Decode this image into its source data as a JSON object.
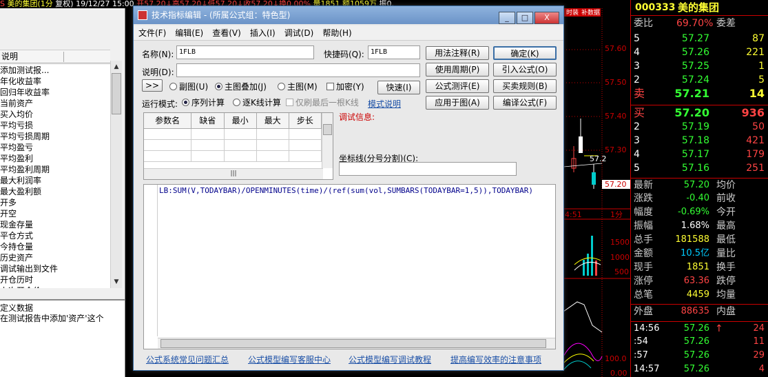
{
  "ticker": {
    "name": "美的集团(1分",
    "date": "复权) 19/12/27 15:00",
    "open": "开57.20",
    "high": "高57.20",
    "low": "低57.20",
    "close": "收57.20",
    "turnover": "换0.00%",
    "volume": "量1851",
    "amount": "额1059万",
    "amp": "振0."
  },
  "left": {
    "header": "说明",
    "items": [
      "添加测试报...",
      "年化收益率",
      "回归年收益率",
      "当前资产",
      "买入均价",
      "平均亏损",
      "平均亏损周期",
      "平均盈亏",
      "平均盈利",
      "平均盈利周期",
      "最大利润率",
      "最大盈利额",
      "开多",
      "开空",
      "现金存量",
      "平仓方式",
      "今持仓量",
      "历史资产",
      "调试输出到文件",
      "开仓历时",
      "上次开仓价"
    ],
    "desc_title": "定义数据",
    "desc_text": "在测试报告中添加'资产'这个"
  },
  "dialog": {
    "title": "技术指标编辑 - (所属公式组：特色型)",
    "title_buttons": [
      "_",
      "□",
      "X"
    ],
    "menu": [
      "文件(F)",
      "编辑(E)",
      "查看(V)",
      "插入(I)",
      "调试(D)",
      "帮助(H)"
    ],
    "name_label": "名称(N):",
    "name_value": "1FLB",
    "hotkey_label": "快捷码(Q):",
    "hotkey_value": "1FLB",
    "desc_label": "说明(D):",
    "desc_value": "",
    "expand_btn": ">>",
    "radio_sub": "副图(U)",
    "radio_main_overlay": "主图叠加(J)",
    "radio_main": "主图(M)",
    "chk_encrypt": "加密(Y)",
    "btn_fast": "快速(I)",
    "run_mode_label": "运行模式:",
    "radio_seq": "序列计算",
    "radio_kline": "逐K线计算",
    "chk_last": "仅刷最后一根K线",
    "mode_link": "模式说明",
    "buttons": {
      "usage_note": "用法注释(R)",
      "use_period": "使用周期(P)",
      "formula_test": "公式测评(E)",
      "apply_chart": "应用于图(A)",
      "ok": "确定(K)",
      "import": "引入公式(O)",
      "trade_rule": "买卖规则(B)",
      "compile": "编译公式(F)"
    },
    "param_headers": [
      "参数名",
      "缺省",
      "最小",
      "最大",
      "步长"
    ],
    "debug_label": "调试信息:",
    "coord_label": "坐标线(分号分割)(C):",
    "code": "LB:SUM(V,TODAYBAR)/OPENMINUTES(time)/(ref(sum(vol,SUMBARS(TODAYBAR=1,5)),TODAYBAR)",
    "links": [
      "公式系统常见问题汇总",
      "公式模型编写客服中心",
      "公式模型编写调试教程",
      "提高编写效率的注意事项"
    ]
  },
  "chart": {
    "top_label": "时装",
    "top_label2": "补数据",
    "prices": [
      "57.60",
      "57.50",
      "57.40",
      "57.30",
      "57.2",
      "57.20"
    ],
    "time_label": "4:51",
    "period_label": "1分",
    "vol_ticks": [
      "1500",
      "1000",
      "500"
    ],
    "bottom_ticks": [
      "100.0",
      "0.00"
    ]
  },
  "right": {
    "code": "000333",
    "name": "美的集团",
    "weibi_label": "委比",
    "weibi_value": "69.70%",
    "weicha_label": "委差",
    "sells": [
      {
        "lv": "5",
        "price": "57.27",
        "vol": "87"
      },
      {
        "lv": "4",
        "price": "57.26",
        "vol": "221"
      },
      {
        "lv": "3",
        "price": "57.25",
        "vol": "1"
      },
      {
        "lv": "2",
        "price": "57.24",
        "vol": "5"
      },
      {
        "lv": "卖",
        "price": "57.21",
        "vol": "14"
      }
    ],
    "buys": [
      {
        "lv": "买",
        "price": "57.20",
        "vol": "936"
      },
      {
        "lv": "2",
        "price": "57.19",
        "vol": "50"
      },
      {
        "lv": "3",
        "price": "57.18",
        "vol": "421"
      },
      {
        "lv": "4",
        "price": "57.17",
        "vol": "179"
      },
      {
        "lv": "5",
        "price": "57.16",
        "vol": "251"
      }
    ],
    "stats": [
      {
        "k": "最新",
        "v": "57.20",
        "k2": "均价"
      },
      {
        "k": "涨跌",
        "v": "-0.40",
        "k2": "前收"
      },
      {
        "k": "幅度",
        "v": "-0.69%",
        "k2": "今开"
      },
      {
        "k": "振幅",
        "v": "1.68%",
        "k2": "最高"
      },
      {
        "k": "总手",
        "v": "181588",
        "k2": "最低"
      },
      {
        "k": "金额",
        "v": "10.5亿",
        "k2": "量比"
      },
      {
        "k": "现手",
        "v": "1851",
        "k2": "换手"
      },
      {
        "k": "涨停",
        "v": "63.36",
        "k2": "跌停"
      },
      {
        "k": "总笔",
        "v": "4459",
        "k2": "均量"
      }
    ],
    "outer_label": "外盘",
    "outer_value": "88635",
    "inner_label": "内盘",
    "ticks": [
      {
        "t": "14:56",
        "p": "57.26",
        "arrow": "↑",
        "v": "24"
      },
      {
        "t": ":54",
        "p": "57.26",
        "arrow": "",
        "v": "11"
      },
      {
        "t": ":57",
        "p": "57.26",
        "arrow": "",
        "v": "29"
      },
      {
        "t": "14:57",
        "p": "57.26",
        "arrow": "",
        "v": "4"
      }
    ]
  }
}
